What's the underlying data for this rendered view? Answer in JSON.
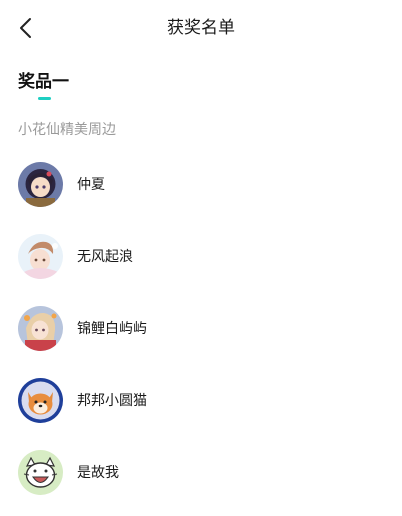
{
  "header": {
    "title": "获奖名单",
    "back_icon": "chevron-left-icon"
  },
  "tab": {
    "label": "奖品一",
    "accent_color": "#1ecfc2"
  },
  "prize": {
    "name": "小花仙精美周边"
  },
  "winners": [
    {
      "name": "仲夏",
      "avatar": "anime-girl-avatar"
    },
    {
      "name": "无风起浪",
      "avatar": "anime-boy-avatar"
    },
    {
      "name": "锦鲤白屿屿",
      "avatar": "anime-girl-lantern-avatar"
    },
    {
      "name": "邦邦小圆猫",
      "avatar": "shiba-dog-avatar"
    },
    {
      "name": "是故我",
      "avatar": "cat-cartoon-avatar"
    }
  ]
}
